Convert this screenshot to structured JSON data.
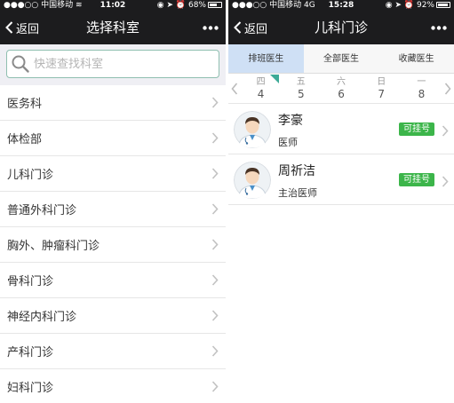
{
  "left_screen": {
    "status": {
      "carrier": "中国移动",
      "time": "11:02",
      "battery": "68%",
      "battery_level": 0.68
    },
    "nav": {
      "back_label": "返回",
      "title": "选择科室"
    },
    "search": {
      "placeholder": "快速查找科室"
    },
    "departments": [
      {
        "label": "医务科"
      },
      {
        "label": "体检部"
      },
      {
        "label": "儿科门诊"
      },
      {
        "label": "普通外科门诊"
      },
      {
        "label": "胸外、肿瘤科门诊"
      },
      {
        "label": "骨科门诊"
      },
      {
        "label": "神经内科门诊"
      },
      {
        "label": "产科门诊"
      },
      {
        "label": "妇科门诊"
      }
    ]
  },
  "right_screen": {
    "status": {
      "carrier": "中国移动",
      "network": "4G",
      "time": "15:28",
      "battery": "92%",
      "battery_level": 0.92
    },
    "nav": {
      "back_label": "返回",
      "title": "儿科门诊"
    },
    "tabs": [
      {
        "label": "排班医生",
        "active": true
      },
      {
        "label": "全部医生",
        "active": false
      },
      {
        "label": "收藏医生",
        "active": false
      }
    ],
    "dates": [
      {
        "weekday": "四",
        "day": "4",
        "selected": true
      },
      {
        "weekday": "五",
        "day": "5",
        "selected": false
      },
      {
        "weekday": "六",
        "day": "6",
        "selected": false
      },
      {
        "weekday": "日",
        "day": "7",
        "selected": false
      },
      {
        "weekday": "一",
        "day": "8",
        "selected": false
      }
    ],
    "doctors": [
      {
        "name": "李豪",
        "title": "医师",
        "action": "可挂号"
      },
      {
        "name": "周祈洁",
        "title": "主治医师",
        "action": "可挂号"
      }
    ]
  },
  "colors": {
    "navbar": "#1c1c1e",
    "active_tab": "#cfe0f5",
    "book_button": "#3cb54a",
    "date_marker": "#3daa97"
  }
}
